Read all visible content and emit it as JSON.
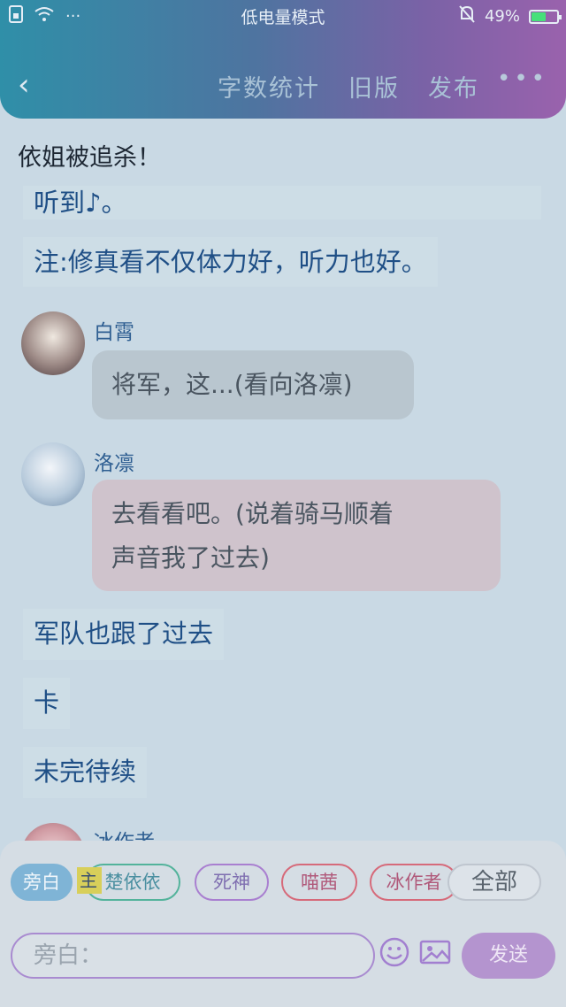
{
  "status": {
    "mode": "低电量模式",
    "battery": "49%",
    "battery_level": 0.49
  },
  "header": {
    "word_count": "字数统计",
    "old_version": "旧版",
    "publish": "发布",
    "more": "•••"
  },
  "chat": {
    "title": "依姐被追杀！",
    "narration_1": "听到♪。",
    "narration_2": "注:修真看不仅体力好，听力也好。",
    "msg1_name": "白霄",
    "msg1_text": "将军，这...(看向洛凛)",
    "msg2_name": "洛凛",
    "msg2_line1": "去看看吧。(说着骑马顺着",
    "msg2_line2": "声音我了过去)",
    "narration_3": "军队也跟了过去",
    "narration_4": "卡",
    "narration_5": "未完待续",
    "msg3_name": "冰作者"
  },
  "chips": {
    "narrator": "旁白",
    "c1": "楚依依",
    "c2": "死神",
    "c3": "喵茜",
    "c4": "冰作者",
    "all": "全部"
  },
  "highlight_char": "主",
  "composer": {
    "placeholder": "旁白：",
    "send": "发送"
  },
  "icons": [
    "sim-icon",
    "wifi-icon",
    "more-dots-icon",
    "bell-muted-icon",
    "battery-icon",
    "back-icon",
    "emoji-icon",
    "image-icon"
  ]
}
